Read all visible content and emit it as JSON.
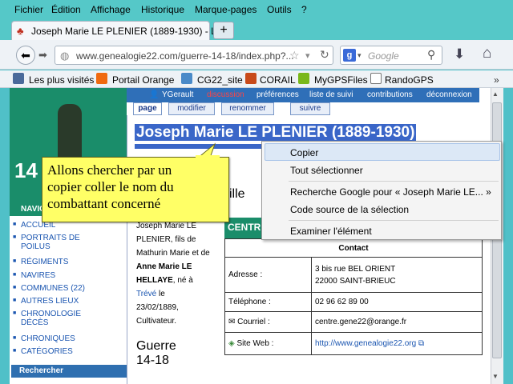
{
  "menu": [
    "Fichier",
    "Édition",
    "Affichage",
    "Historique",
    "Marque-pages",
    "Outils",
    "?"
  ],
  "tab": {
    "title": "Joseph Marie LE PLENIER (1889-1930) - L...",
    "close": "×",
    "new": "+"
  },
  "address": {
    "url": "www.genealogie22.com/guerre-14-18/index.php?..."
  },
  "search": {
    "placeholder": "Google"
  },
  "bookmarks": [
    "Les plus visités",
    "Portail Orange",
    "CG22_site",
    "CORAIL",
    "MyGPSFiles",
    "RandoGPS"
  ],
  "wiki_top": {
    "user": "YGerault",
    "discussion": "discussion",
    "prefs": "préférences",
    "watch": "liste de suivi",
    "contrib": "contributions",
    "logout": "déconnexion"
  },
  "page_tabs": [
    "page",
    "modifier",
    "renommer",
    "suivre"
  ],
  "title": "Joseph Marie LE PLENIER (1889-1930)",
  "banner_text": "14",
  "nav": {
    "header": "NAVIG",
    "items": [
      "ACCUEIL",
      "PORTRAITS DE POILUS",
      "RÉGIMENTS",
      "NAVIRES",
      "COMMUNES (22)",
      "AUTRES LIEUX",
      "CHRONOLOGIE DÉCÈS",
      "CHRONIQUES",
      "CATÉGORIES"
    ],
    "search_header": "Rechercher"
  },
  "bio": {
    "l1": "Joseph Marie LE",
    "l2": "PLENIER, fils de",
    "l3": "Mathurin Marie et de",
    "l4": "Anne Marie LE",
    "l5": "HELLAYE",
    "l5b": ", né à",
    "l6": "Trévé",
    "l6b": " le",
    "l7": "23/02/1889,",
    "l8": "Cultivateur."
  },
  "section": {
    "ille": "ille",
    "guerre1": "Guerre",
    "guerre2": "14-18",
    "centre": "CENTR"
  },
  "contact": {
    "header": "Contact",
    "adresse_label": "Adresse :",
    "adresse1": "3 bis rue BEL ORIENT",
    "adresse2": "22000 SAINT-BRIEUC",
    "tel_label": "Téléphone :",
    "tel": "02 96 62 89 00",
    "mail_label": "Courriel :",
    "mail": "centre.gene22@orange.fr",
    "web_label": "Site Web :",
    "web": "http://www.genealogie22.org"
  },
  "context_menu": [
    "Copier",
    "Tout sélectionner",
    "Recherche Google pour « Joseph Marie LE... »",
    "Code source de la sélection",
    "Examiner l'élément"
  ],
  "tooltip": {
    "l1": "Allons chercher par un",
    "l2": "copier coller le nom du",
    "l3": "combattant concerné"
  }
}
